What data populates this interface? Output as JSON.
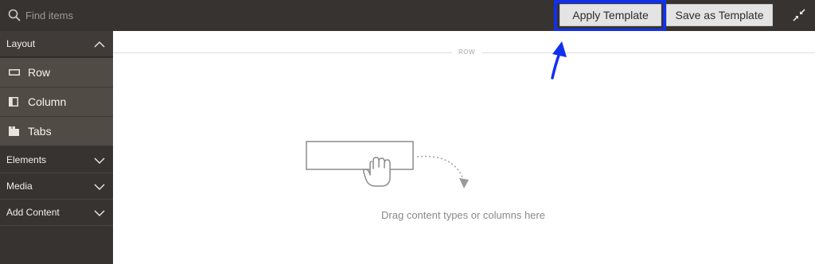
{
  "topbar": {
    "search": {
      "placeholder": "Find items",
      "icon": "search-icon"
    },
    "apply_template_label": "Apply Template",
    "save_as_template_label": "Save as Template",
    "fullscreen_icon": "collapse-fullscreen-icon",
    "highlight_color": "#1030f0"
  },
  "sidebar": {
    "layout": {
      "label": "Layout",
      "expanded": true,
      "items": [
        {
          "label": "Row",
          "icon": "row-icon"
        },
        {
          "label": "Column",
          "icon": "column-icon"
        },
        {
          "label": "Tabs",
          "icon": "tabs-icon"
        }
      ]
    },
    "sections": [
      {
        "label": "Elements",
        "expanded": false
      },
      {
        "label": "Media",
        "expanded": false
      },
      {
        "label": "Add Content",
        "expanded": false
      }
    ]
  },
  "stage": {
    "row_label": "ROW",
    "drop_hint": "Drag content types or columns here"
  },
  "colors": {
    "toolbar_bg": "#373330",
    "sidebar_item_bg": "#514b46",
    "button_bg": "#e4e4e4",
    "annotation_blue": "#1030f0"
  }
}
